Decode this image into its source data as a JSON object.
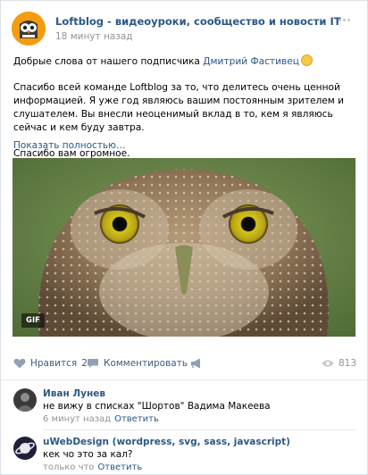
{
  "post": {
    "author": "Loftblog - видеоуроки, сообщество и новости IT",
    "time": "18 минут назад",
    "line1_prefix": "Добрые слова от нашего подписчика ",
    "line1_link": "Дмитрий Фастивец",
    "paragraph2": "Спасибо всей команде Loftblog за то, что делитесь очень ценной информацией. Я уже год являюсь вашим постоянным зрителем и слушателем. Вы внесли неоценимый вклад в то, кем я являюсь сейчас и кем буду завтра.",
    "paragraph3": "Спасибо вам огромное.",
    "show_more": "Показать полностью…",
    "media_badge": "GIF"
  },
  "actions": {
    "like_label": "Нравится",
    "like_count": "2",
    "comment_label": "Комментировать",
    "views": "813"
  },
  "comments": [
    {
      "name": "Иван Лунев",
      "text": "не вижу в списках \"Шортов\" Вадима Макеева",
      "time": "6 минут назад",
      "reply": "Ответить"
    },
    {
      "name": "uWebDesign (wordpress, svg, sass, javascript)",
      "text": "кек чо это за кал?",
      "time": "только что",
      "reply": "Ответить"
    }
  ],
  "colors": {
    "link": "#2a5885",
    "meta": "#939393",
    "avatar_brand": "#f39c12"
  }
}
